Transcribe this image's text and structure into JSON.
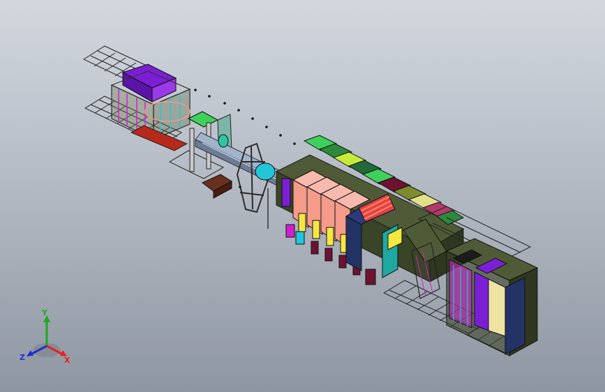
{
  "viewport": {
    "background_top": "#d3d8df",
    "background_bottom": "#8e96a1"
  },
  "model": {
    "colors": {
      "frame": "#2b2b2b",
      "base": "#4f5b36",
      "purple": "#7b1fd6",
      "magenta": "#d21fd1",
      "cyan": "#22c6d6",
      "green": "#3ed15a",
      "salmon": "#f49b8a",
      "yellow": "#f4e740",
      "maroon": "#6e1230",
      "olive": "#7c8b2e",
      "navy": "#233366",
      "cream": "#efe3a4"
    },
    "icons": [
      "grid-mesh-icon",
      "conveyor-icon",
      "wheel-icon",
      "bolt-icon"
    ]
  },
  "triad": {
    "x_label": "X",
    "y_label": "Y",
    "z_label": "Z",
    "x_color": "#e62020",
    "y_color": "#1fa81f",
    "z_color": "#2030d0"
  }
}
